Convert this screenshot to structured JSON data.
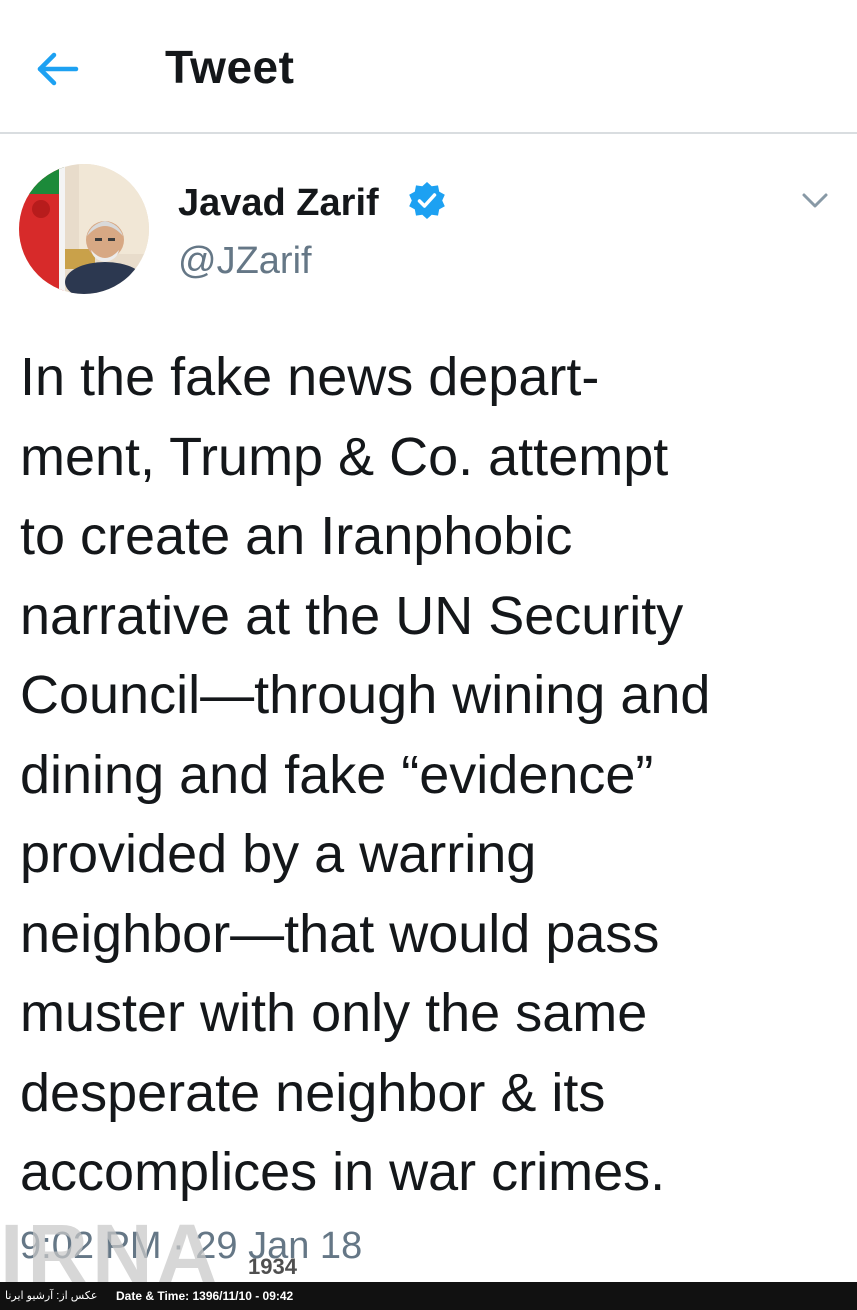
{
  "header": {
    "back_icon": "arrow-left-icon",
    "title": "Tweet"
  },
  "colors": {
    "accent": "#1da1f2",
    "text_primary": "#14171a",
    "text_secondary": "#657786"
  },
  "tweet": {
    "author_name": "Javad Zarif",
    "verified_icon": "verified-badge-icon",
    "handle": "@JZarif",
    "menu_icon": "chevron-down-icon",
    "text_lines": [
      "In the fake news depart-",
      "ment, Trump & Co. attempt",
      "to create an Iranphobic",
      "narrative at the UN Security",
      "Council—through wining and",
      "dining and fake “evidence”",
      "provided by a warring",
      "neighbor—that would pass",
      "muster with only the same",
      "desperate neighbor & its",
      "accomplices in war crimes."
    ],
    "timestamp": "9:02 PM · 29 Jan 18"
  },
  "watermark": {
    "logo_text": "IRNA",
    "year": "1934"
  },
  "archive": {
    "caption": "عکس از: آرشیو ایرنا",
    "datetime": "Date & Time: 1396/11/10 - 09:42"
  }
}
